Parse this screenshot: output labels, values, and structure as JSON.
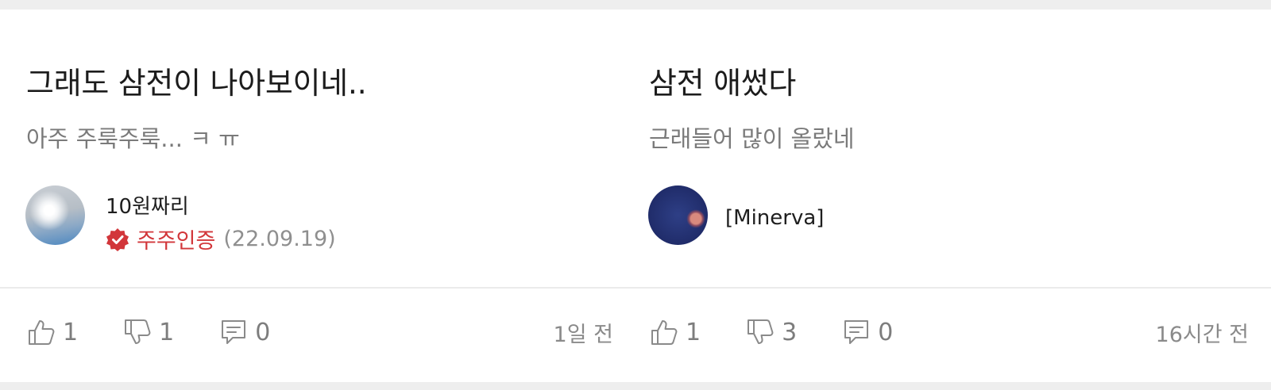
{
  "posts": [
    {
      "title": "그래도 삼전이 나아보이네..",
      "snippet": "아주 주룩주룩... ㅋ ㅠ",
      "author": {
        "name": "10원짜리",
        "avatar": "sky-photo-avatar",
        "verified_label": "주주인증",
        "verified_date": "(22.09.19)"
      },
      "likes": "1",
      "dislikes": "1",
      "comments": "0",
      "time": "1일 전"
    },
    {
      "title": "삼전 애썼다",
      "snippet": "근래들어 많이 올랐네",
      "author": {
        "name": "[Minerva]",
        "avatar": "moon-photo-avatar"
      },
      "likes": "1",
      "dislikes": "3",
      "comments": "0",
      "time": "16시간 전"
    }
  ],
  "icons": {
    "like": "thumbs-up-icon",
    "dislike": "thumbs-down-icon",
    "comment": "comment-icon",
    "verified": "verified-badge-icon"
  },
  "colors": {
    "verified": "#d2363a",
    "meta": "#7d7d7d"
  }
}
